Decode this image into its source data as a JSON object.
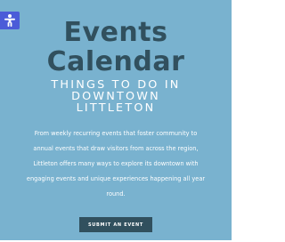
{
  "icons": {
    "accessibility": "accessibility-icon"
  },
  "colors": {
    "hero_background": "#79b2cf",
    "title_text": "#31505e",
    "subtitle_text": "#ffffff",
    "body_text": "#ffffff",
    "button_background": "#31505e",
    "button_text": "#ffffff",
    "accessibility_button": "#4b5cd8"
  },
  "hero": {
    "title_lines": [
      "Events",
      "Calendar"
    ],
    "subtitle_lines": [
      "THINGS TO DO IN",
      "DOWNTOWN",
      "LITTLETON"
    ],
    "description_lines": [
      "From weekly recurring events that foster community to",
      "annual events that draw visitors from across the region,",
      "Littleton offers many ways to explore its downtown with",
      "engaging events and unique experiences happening all year",
      "round."
    ],
    "submit_button_label": "SUBMIT AN EVENT"
  }
}
